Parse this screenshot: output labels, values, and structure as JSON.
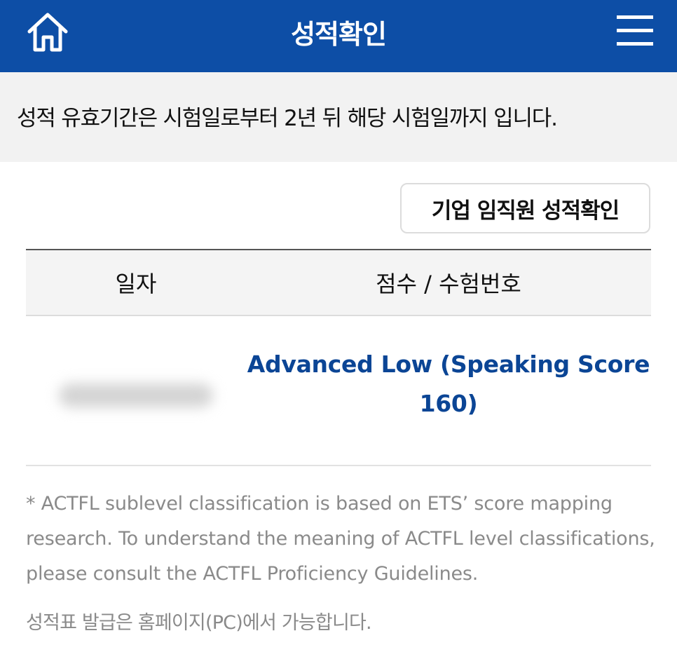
{
  "header": {
    "title": "성적확인",
    "home_icon": "home-icon",
    "menu_icon": "hamburger-menu-icon"
  },
  "notice": {
    "text": "성적 유효기간은 시험일로부터 2년 뒤 해당 시험일까지 입니다."
  },
  "corporate_button": {
    "label": "기업 임직원 성적확인"
  },
  "table": {
    "headers": {
      "date": "일자",
      "score": "점수 / 수험번호"
    },
    "rows": [
      {
        "score": "Advanced Low (Speaking Score 160)"
      }
    ]
  },
  "footnote": {
    "text": "* ACTFL sublevel classification is based on ETS’ score mapping research. To understand the meaning of ACTFL level classifications, please consult the ACTFL Proficiency Guidelines."
  },
  "issue_note": {
    "text": "성적표 발급은 홈페이지(PC)에서 가능합니다."
  },
  "colors": {
    "header_bg": "#0d4ea6",
    "score_text": "#0b4595",
    "notice_bg": "#f2f2f2",
    "muted_text": "#8a8a8a"
  }
}
